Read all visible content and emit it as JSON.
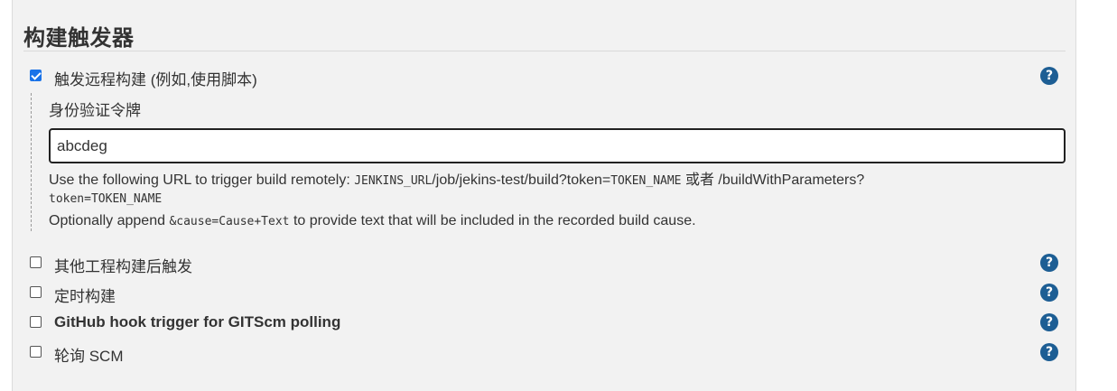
{
  "section": {
    "title": "构建触发器"
  },
  "remote_trigger": {
    "checked": true,
    "label": "触发远程构建 (例如,使用脚本)",
    "token_label": "身份验证令牌",
    "token_value": "abcdeg",
    "desc": {
      "prefix": "Use the following URL to trigger build remotely: ",
      "code1": "JENKINS_URL",
      "mid": "/job/jekins-test/build?token=",
      "code2": "TOKEN_NAME",
      "or": " 或者 /buildWithParameters?",
      "code3": "token=TOKEN_NAME",
      "optional_prefix": "Optionally append ",
      "code4": "&cause=Cause+Text",
      "optional_suffix": " to provide text that will be included in the recorded build cause."
    }
  },
  "triggers": [
    {
      "label": "其他工程构建后触发",
      "checked": false
    },
    {
      "label": "定时构建",
      "checked": false
    },
    {
      "label": "GitHub hook trigger for GITScm polling",
      "checked": false
    },
    {
      "label": "轮询 SCM",
      "checked": false
    }
  ],
  "help_icon": {
    "glyph": "?",
    "color": "#1d5e94"
  },
  "colors": {
    "checkbox_checked": "#1a73e8",
    "panel_bg": "#f2f2f2"
  }
}
